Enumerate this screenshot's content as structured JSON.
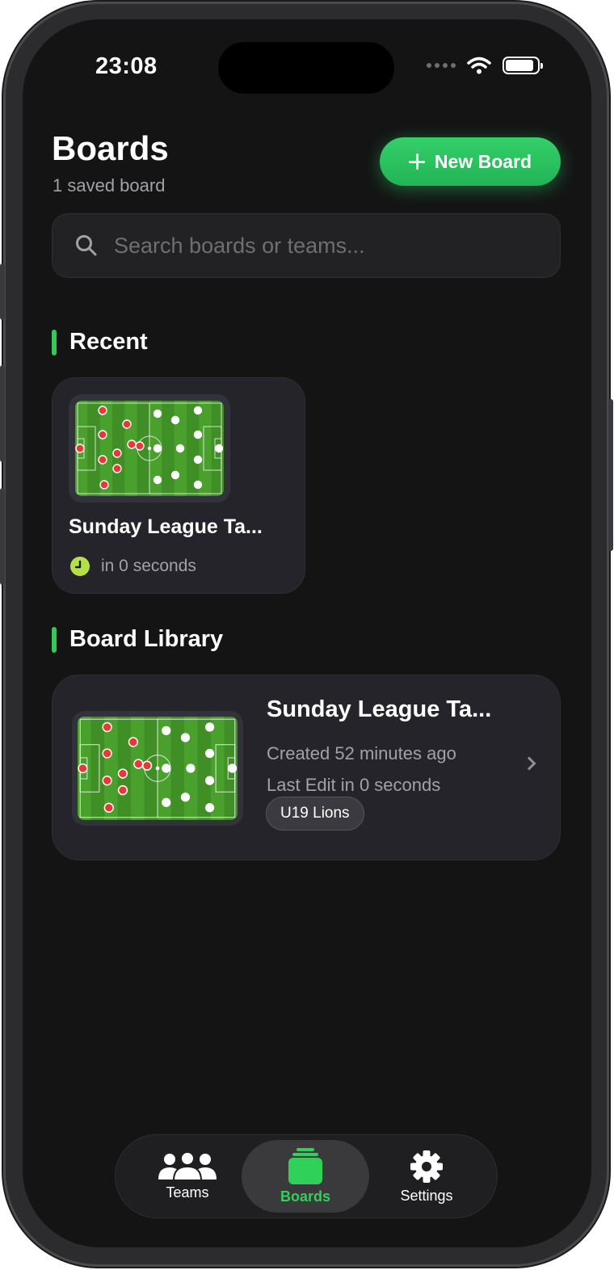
{
  "status": {
    "time": "23:08",
    "battery_level": 0.9
  },
  "header": {
    "title": "Boards",
    "subtitle": "1 saved board",
    "new_board_label": "New Board"
  },
  "search": {
    "placeholder": "Search boards or teams..."
  },
  "recent": {
    "section_label": "Recent",
    "card": {
      "title": "Sunday League Ta...",
      "time_label": "in 0 seconds"
    }
  },
  "library": {
    "section_label": "Board Library",
    "card": {
      "title": "Sunday League Ta...",
      "created": "Created 52 minutes ago",
      "last_edit": "Last Edit in 0 seconds",
      "tag": "U19 Lions"
    }
  },
  "tabs": [
    {
      "label": "Teams",
      "icon": "people-icon",
      "active": false
    },
    {
      "label": "Boards",
      "icon": "boards-icon",
      "active": true
    },
    {
      "label": "Settings",
      "icon": "gear-icon",
      "active": false
    }
  ],
  "colors": {
    "accent": "#34c759",
    "background": "#141414",
    "card": "#24242a",
    "home_player": "#e53935",
    "away_player": "#ffffff"
  }
}
